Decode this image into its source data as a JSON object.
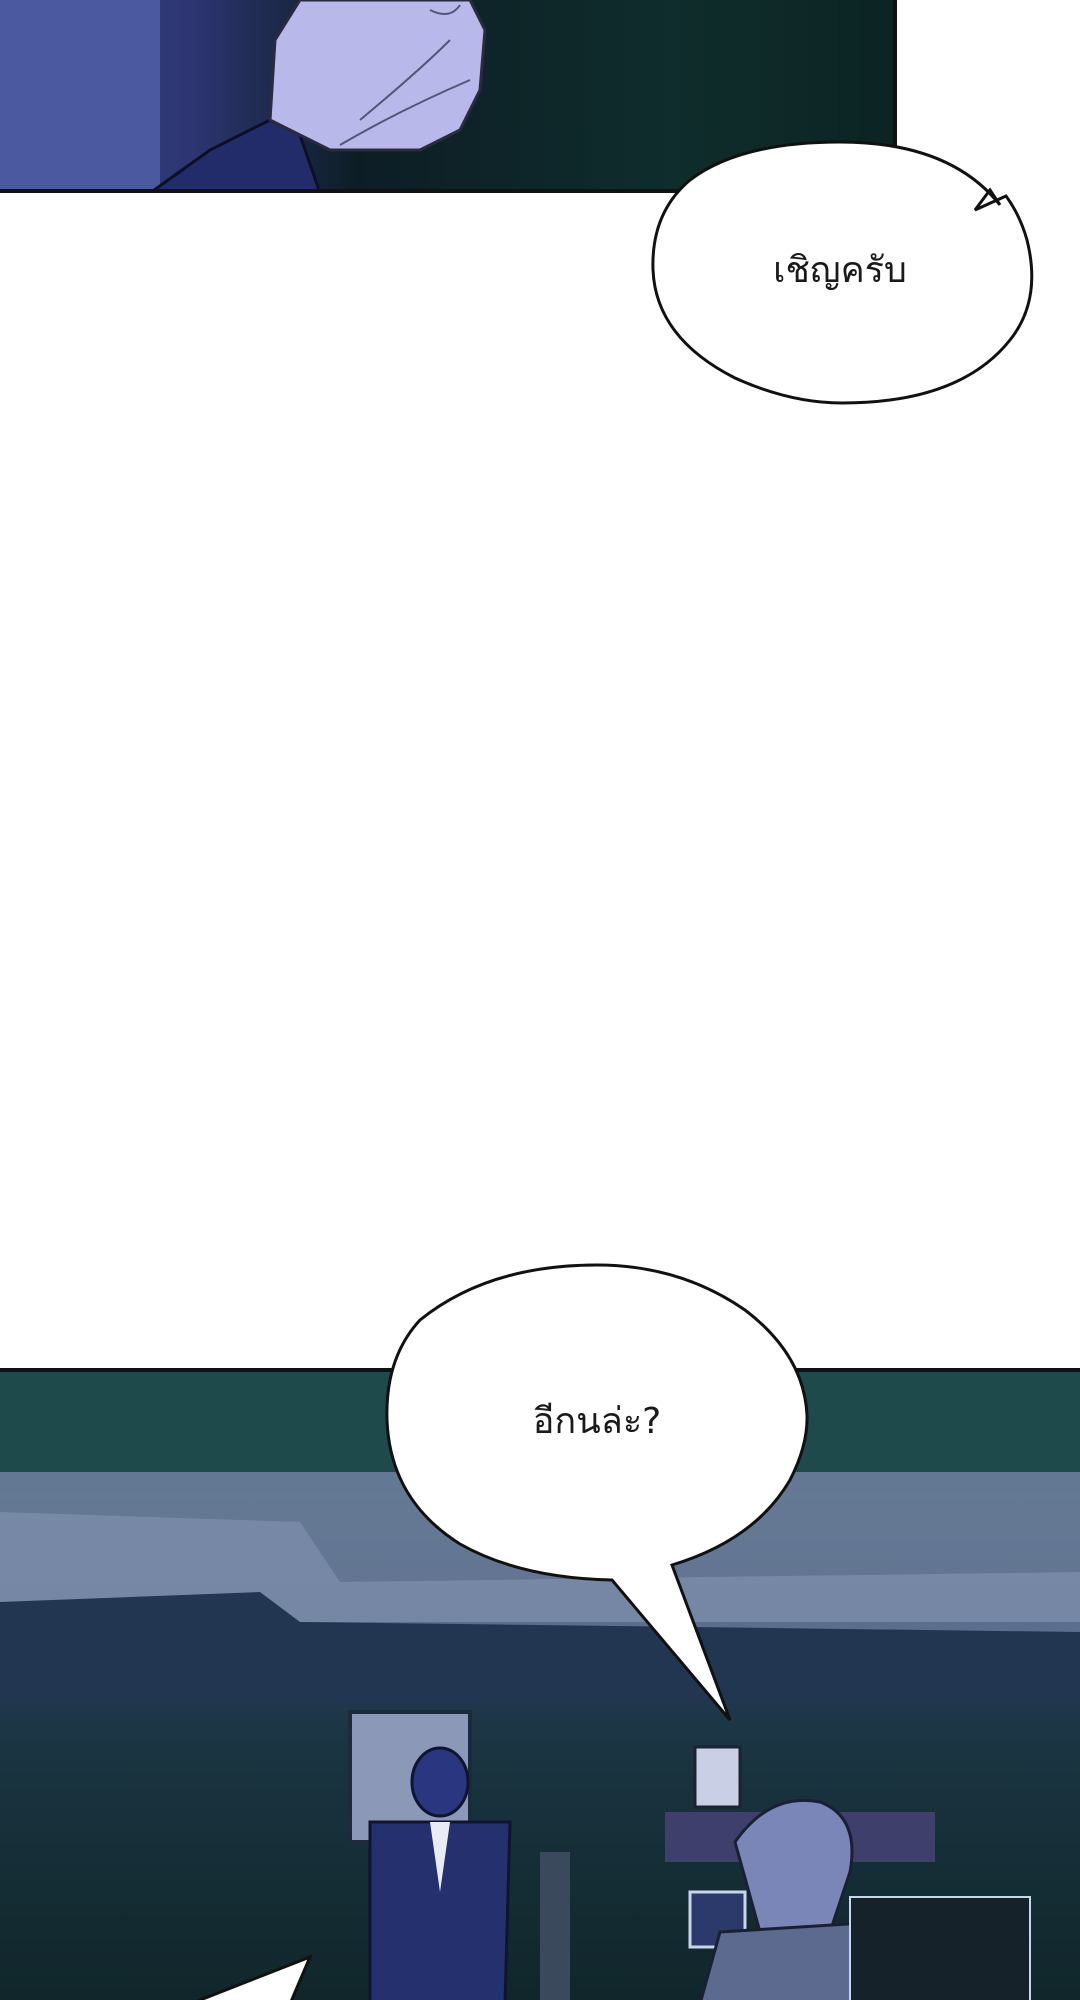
{
  "bubbles": {
    "top": {
      "text": "เชิญครับ"
    },
    "middle": {
      "text": "อีกนล่ะ?"
    }
  }
}
